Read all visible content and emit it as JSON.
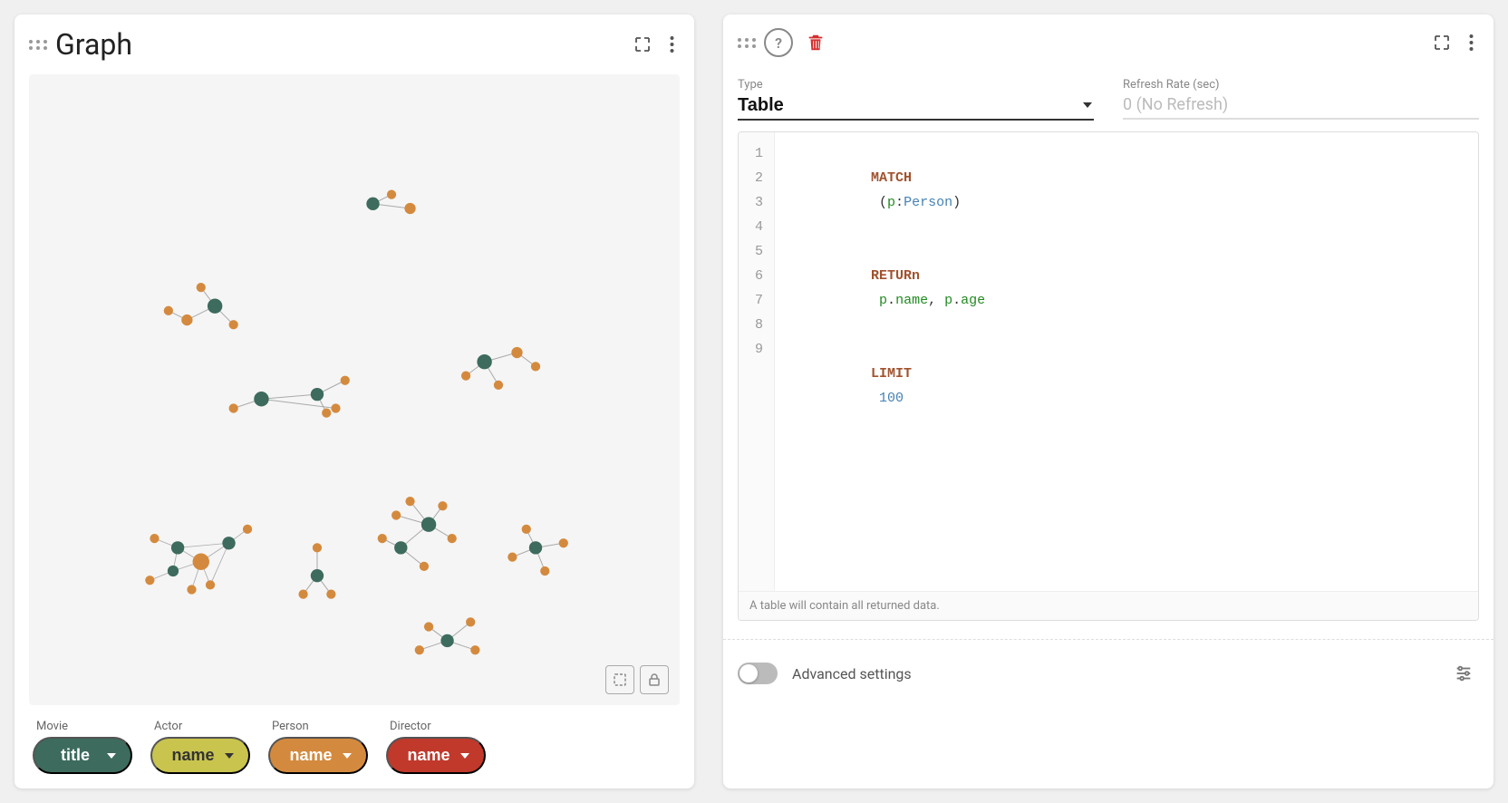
{
  "left_panel": {
    "title": "Graph",
    "legend": {
      "items": [
        {
          "id": "movie",
          "category": "Movie",
          "prop": "title",
          "color": "#3d6b5e"
        },
        {
          "id": "actor",
          "category": "Actor",
          "prop": "name",
          "color": "#c9c44e"
        },
        {
          "id": "person",
          "category": "Person",
          "prop": "name",
          "color": "#d48a3e"
        },
        {
          "id": "director",
          "category": "Director",
          "prop": "name",
          "color": "#c0392b"
        }
      ]
    }
  },
  "right_panel": {
    "type_label": "Type",
    "type_value": "Table",
    "refresh_label": "Refresh Rate (sec)",
    "refresh_value": "0 (No Refresh)",
    "code": {
      "lines": [
        {
          "num": 1,
          "content": "MATCH (p:Person)"
        },
        {
          "num": 2,
          "content": "RETURn p.name, p.age"
        },
        {
          "num": 3,
          "content": "LIMIT 100"
        },
        {
          "num": 4,
          "content": ""
        },
        {
          "num": 5,
          "content": ""
        },
        {
          "num": 6,
          "content": ""
        },
        {
          "num": 7,
          "content": ""
        },
        {
          "num": 8,
          "content": ""
        },
        {
          "num": 9,
          "content": ""
        }
      ],
      "hint": "A table will contain all returned data."
    },
    "advanced_settings_label": "Advanced settings"
  },
  "icons": {
    "drag_handle": "drag-handle-icon",
    "fullscreen": "fullscreen-icon",
    "more_vert": "more-vert-icon",
    "help": "help-icon",
    "delete": "delete-icon",
    "selection": "selection-icon",
    "lock": "lock-icon",
    "sliders": "sliders-icon",
    "toggle": "toggle-icon"
  }
}
